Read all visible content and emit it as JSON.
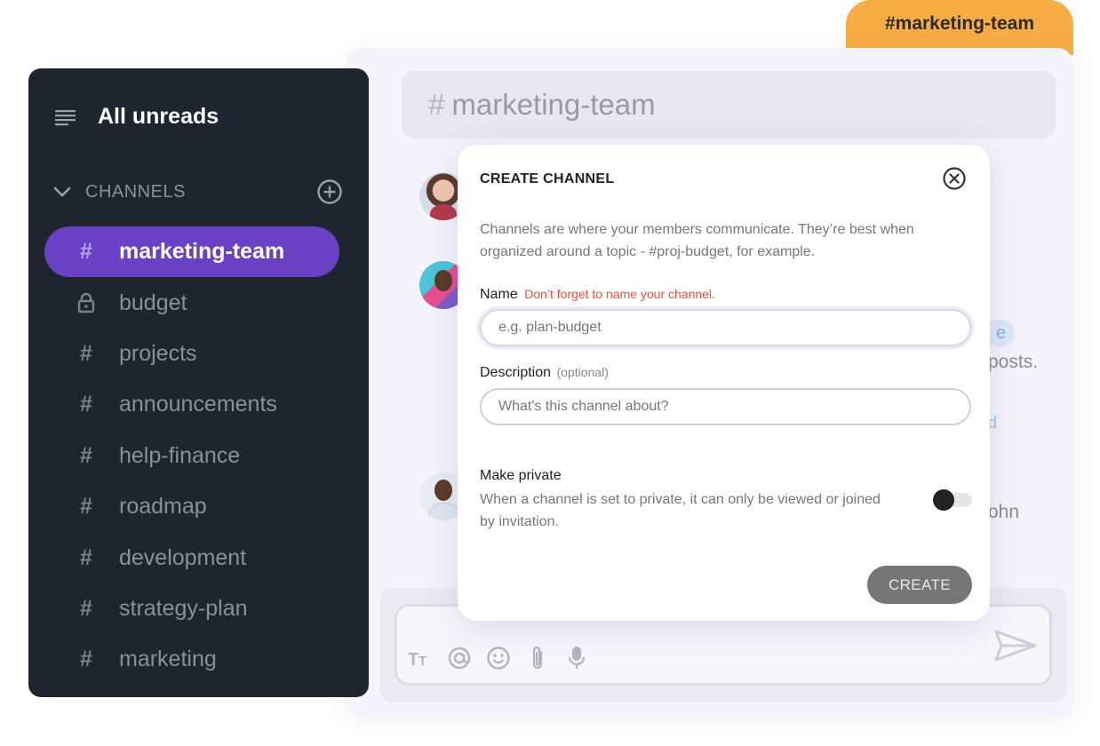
{
  "top_tab": {
    "label": "#marketing-team"
  },
  "chat": {
    "header": {
      "hash": "#",
      "channel_name": "marketing-team"
    },
    "peek_texts": {
      "mention_fragment": "e",
      "line1_fragment": "posts.",
      "link_fragment": "d",
      "name_fragment": "ohn"
    }
  },
  "composer": {
    "tools": [
      "text-format-icon",
      "mention-icon",
      "emoji-icon",
      "attachment-icon",
      "microphone-icon"
    ],
    "send_icon": "send-icon"
  },
  "sidebar": {
    "all_unreads_label": "All unreads",
    "channels_header": "CHANNELS",
    "channels": [
      {
        "name": "marketing-team",
        "icon": "hash",
        "active": true
      },
      {
        "name": "budget",
        "icon": "lock",
        "active": false
      },
      {
        "name": "projects",
        "icon": "hash",
        "active": false
      },
      {
        "name": "announcements",
        "icon": "hash",
        "active": false
      },
      {
        "name": "help-finance",
        "icon": "hash",
        "active": false
      },
      {
        "name": "roadmap",
        "icon": "hash",
        "active": false
      },
      {
        "name": "development",
        "icon": "hash",
        "active": false
      },
      {
        "name": "strategy-plan",
        "icon": "hash",
        "active": false
      },
      {
        "name": "marketing",
        "icon": "hash",
        "active": false
      }
    ]
  },
  "modal": {
    "title": "CREATE CHANNEL",
    "description": "Channels are where your members communicate. They’re best when organized around a topic - #proj-budget, for example.",
    "name_label": "Name",
    "name_hint": "Don’t forget to name your channel.",
    "name_placeholder": "e.g. plan-budget",
    "name_value": "",
    "description_label": "Description",
    "description_optional": "(optional)",
    "description_placeholder": "What's this channel about?",
    "description_value": "",
    "make_private_label": "Make private",
    "make_private_desc": "When a channel is set to private, it can only be viewed or joined by invitation.",
    "make_private_on": false,
    "create_button": "CREATE"
  },
  "colors": {
    "accent": "#6a41c4",
    "sidebar_bg": "#1e252f",
    "tab_orange": "#f7ad44",
    "hint_red": "#e8553e",
    "button_gray": "#767676"
  }
}
